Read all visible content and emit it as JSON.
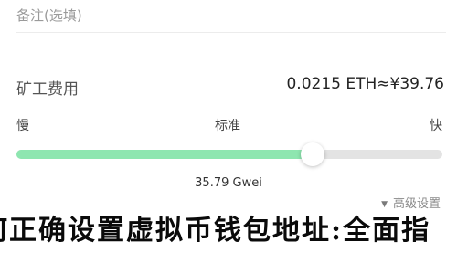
{
  "note": {
    "placeholder": "备注(选填)"
  },
  "fee": {
    "label": "矿工费用",
    "value": "0.0215 ETH≈¥39.76"
  },
  "speed": {
    "slow_label": "慢",
    "normal_label": "标准",
    "fast_label": "快",
    "slider_fraction": 0.695,
    "gas_price": "35.79 Gwei",
    "fill_color": "#8ee6b0"
  },
  "advanced": {
    "arrow_icon": "triangle-down-icon",
    "label": "高级设置"
  },
  "overlay": {
    "text": "何正确设置虚拟币钱包地址:全面指"
  }
}
